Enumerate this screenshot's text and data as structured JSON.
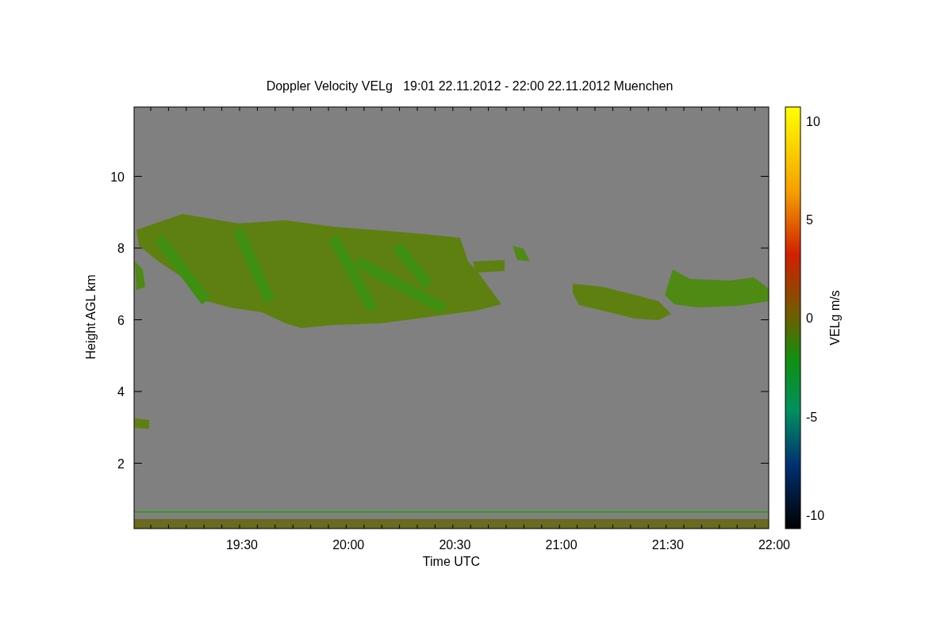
{
  "plot": {
    "title": "Doppler Velocity VELg   19:01 22.11.2012 - 22:00 22.11.2012 Muenchen",
    "xlabel": "Time UTC",
    "ylabel": "Height AGL km",
    "xticks": [
      "19:30",
      "20:00",
      "20:30",
      "21:00",
      "21:30",
      "22:00"
    ],
    "yticks": [
      "10",
      "8",
      "6",
      "4",
      "2"
    ]
  },
  "colorbar": {
    "label": "VELg m/s",
    "ticks": [
      "10",
      "5",
      "0",
      "-5",
      "-10"
    ]
  }
}
